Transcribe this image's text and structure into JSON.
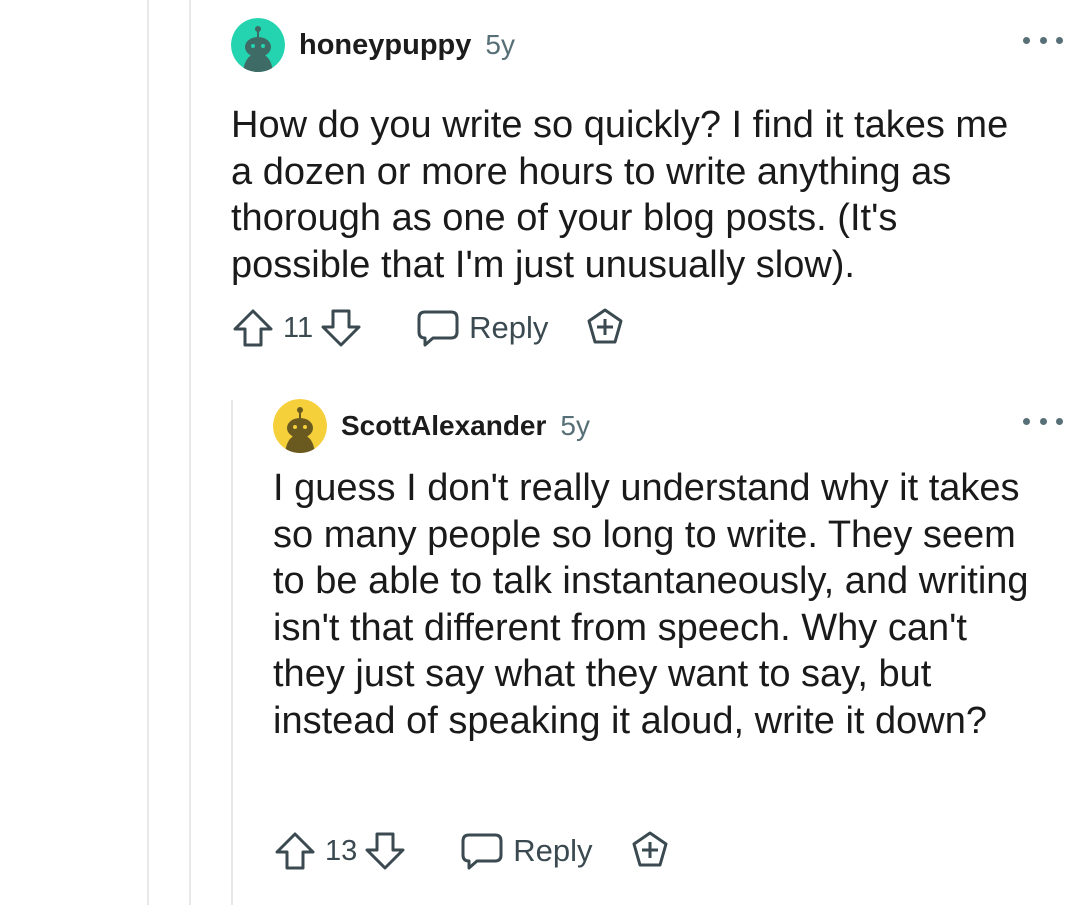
{
  "comments": [
    {
      "username": "honeypuppy",
      "age": "5y",
      "body": "How do you write so quickly? I find it takes me a dozen or more hours to write anything as thorough as one of your blog posts. (It's possible that I'm just unusually slow).",
      "votes": "11",
      "reply_label": "Reply",
      "avatar_color": "#24d4b0"
    },
    {
      "username": "ScottAlexander",
      "age": "5y",
      "body": "I guess I don't really understand why it takes so many people so long to write. They seem to be able to talk instantaneously, and writing isn't that different from speech. Why can't they just say what they want to say, but instead of speaking it aloud, write it down?",
      "votes": "13",
      "reply_label": "Reply",
      "avatar_color": "#f5d03a"
    }
  ],
  "icons": {
    "avatar": "snoo-avatar-icon",
    "upvote": "arrow-up-icon",
    "downvote": "arrow-down-icon",
    "reply": "speech-bubble-icon",
    "award": "award-plus-icon",
    "more": "more-options-icon"
  },
  "colors": {
    "text": "#1a1a1b",
    "meta": "#576f76",
    "thread_line": "#e6e8ea"
  }
}
